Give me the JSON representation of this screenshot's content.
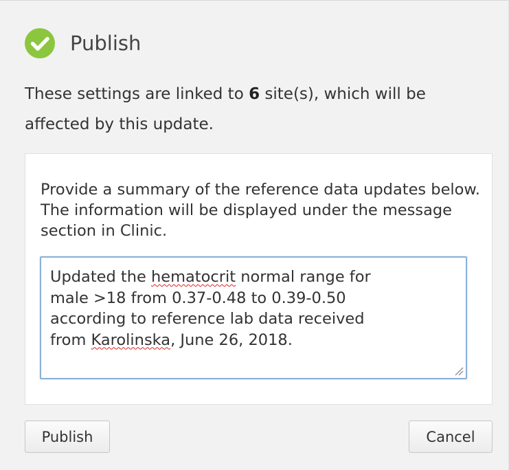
{
  "dialog": {
    "title": "Publish",
    "description": {
      "prefix": "These settings are linked to ",
      "count": "6",
      "suffix": " site(s), which will be affected by this update."
    }
  },
  "panel": {
    "instructions": "Provide a summary of the reference data updates below. The information will be displayed under the message section in Clinic.",
    "summary": {
      "line1_a": "Updated the ",
      "line1_b": "hematocrit",
      "line1_c": " normal range for",
      "line2": "male >18 from 0.37-0.48 to 0.39-0.50",
      "line3": "according to reference lab data received",
      "line4_a": "from ",
      "line4_b": "Karolinska",
      "line4_c": ", June 26, 2018."
    }
  },
  "buttons": {
    "publish": "Publish",
    "cancel": "Cancel"
  },
  "colors": {
    "success_green": "#8cc63f",
    "focus_border": "#8ab0d8",
    "background": "#f2f2f2"
  },
  "icons": {
    "title_icon": "check-circle-icon",
    "resize": "resize-grip-icon"
  }
}
